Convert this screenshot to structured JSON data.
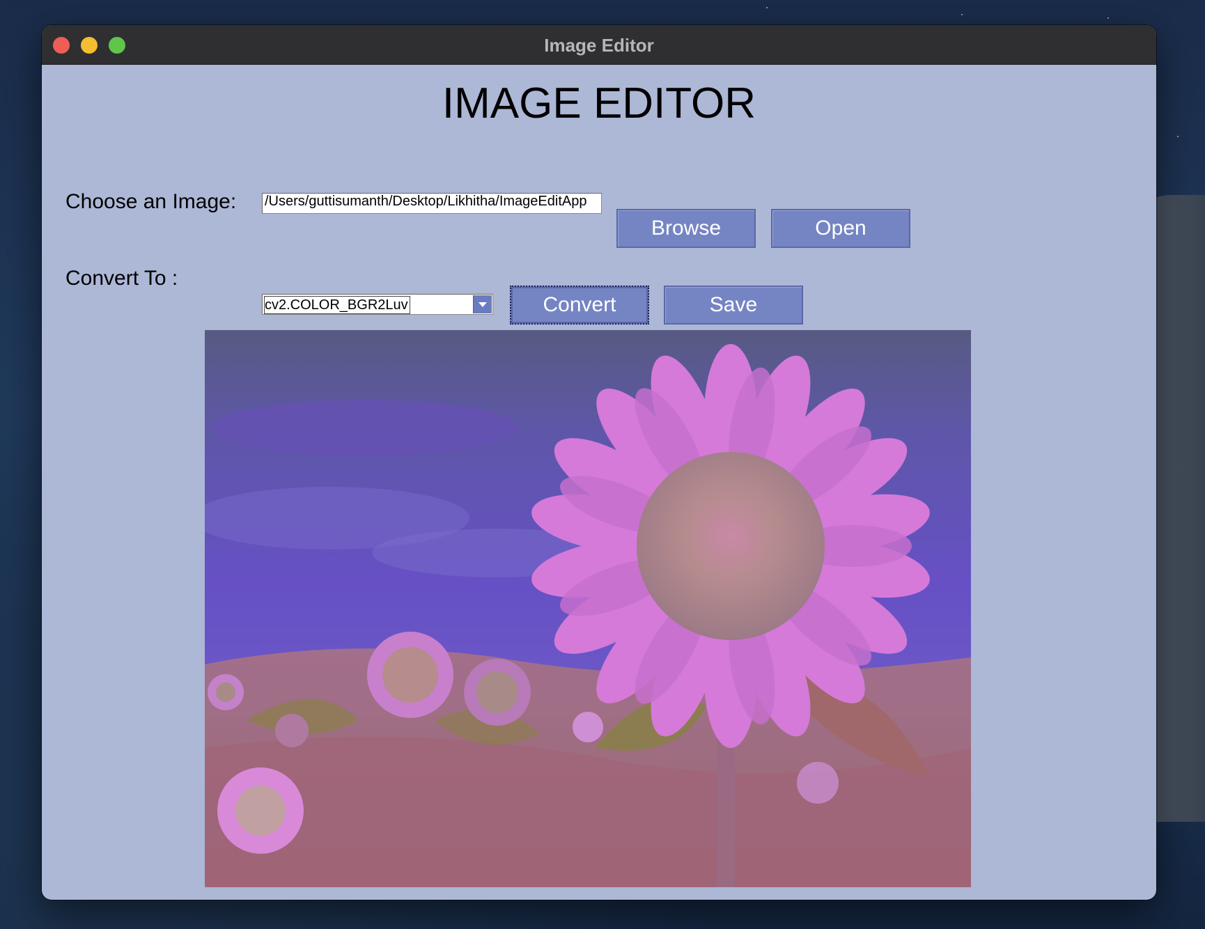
{
  "window": {
    "title": "Image Editor"
  },
  "page": {
    "heading": "IMAGE EDITOR"
  },
  "form": {
    "choose_label": "Choose an Image:",
    "path_value": "/Users/guttisumanth/Desktop/Likhitha/ImageEditApp",
    "browse_label": "Browse",
    "open_label": "Open",
    "convert_to_label": "Convert To :",
    "conversion_selected": "cv2.COLOR_BGR2Luv",
    "convert_label": "Convert",
    "save_label": "Save"
  },
  "preview": {
    "subject": "sunflower field (Luv color-converted)"
  },
  "colors": {
    "window_bg": "#adb7d6",
    "button_bg": "#7585c4",
    "titlebar_bg": "#2f2f31"
  }
}
